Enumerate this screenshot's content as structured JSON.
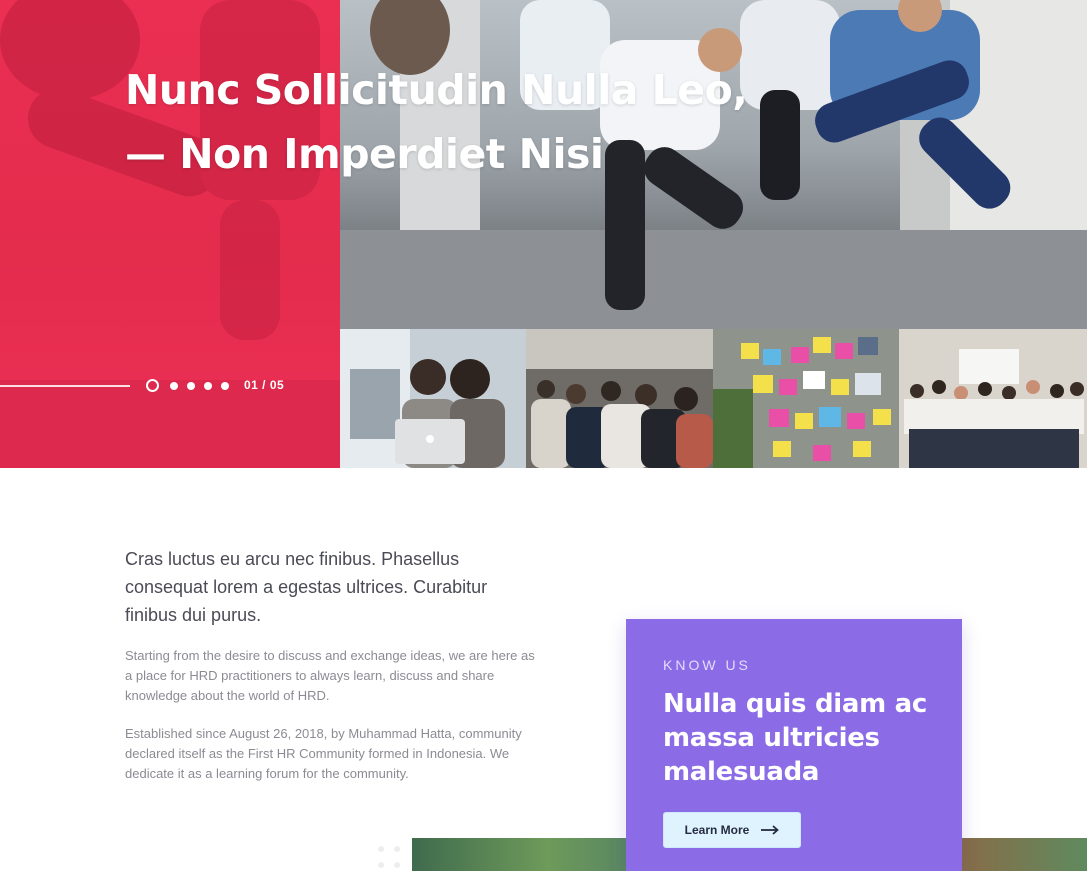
{
  "hero": {
    "title_line1": "Nunc Sollicitudin Nulla Leo,",
    "title_line2": "— Non Imperdiet Nisi",
    "slide_counter": "01 / 05",
    "slide_total": 5,
    "slide_active": 1
  },
  "thumbnails": [
    {
      "name": "women-with-laptop"
    },
    {
      "name": "seated-audience"
    },
    {
      "name": "sticky-notes-board"
    },
    {
      "name": "group-photo"
    }
  ],
  "content": {
    "lead": "Cras luctus eu arcu nec finibus. Phasellus consequat lorem a egestas ultrices. Curabitur finibus dui purus.",
    "paragraph1": "Starting from the desire to discuss and exchange ideas, we are here as a place for HRD practitioners to always learn, discuss and share knowledge about the world of HRD.",
    "paragraph2": "Established since August 26, 2018, by Muhammad Hatta, community declared itself as the First HR Community formed in Indonesia. We dedicate it as a learning forum for the community."
  },
  "card": {
    "eyebrow": "KNOW US",
    "heading": "Nulla quis diam ac massa ultricies malesuada",
    "button_label": "Learn More",
    "button_icon": "arrow-right-icon",
    "background_color": "#8c6ce6"
  },
  "colors": {
    "hero_red": "#e42c4d",
    "card_purple": "#8c6ce6",
    "button_bg": "#dff3ff"
  }
}
